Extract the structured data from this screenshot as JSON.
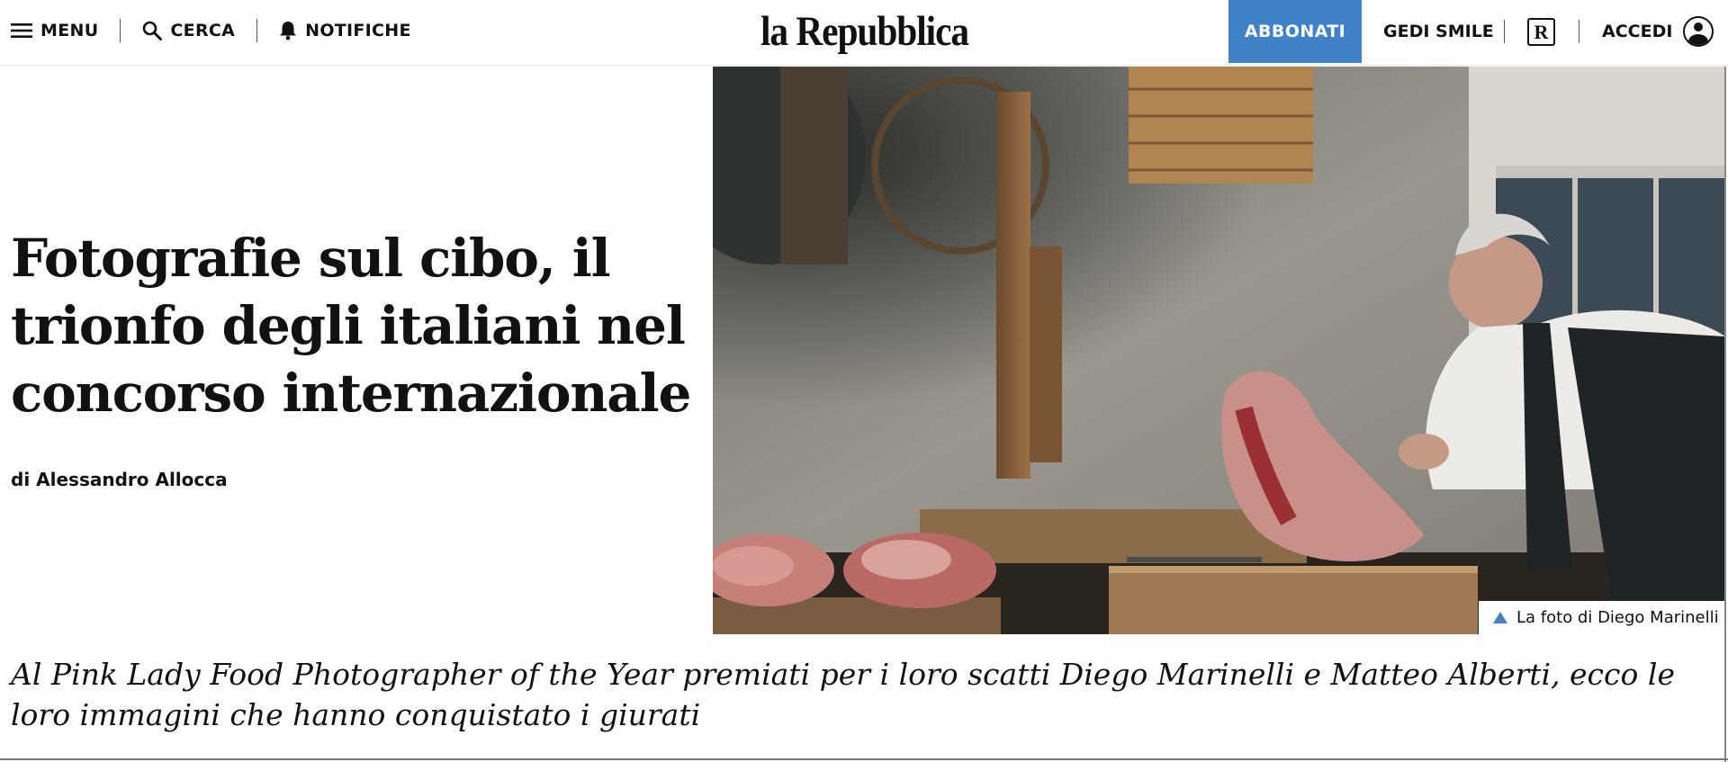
{
  "header": {
    "menu_label": "MENU",
    "search_label": "CERCA",
    "notifications_label": "NOTIFICHE",
    "logo_text": "la Repubblica",
    "subscribe_label": "ABBONATI",
    "gedi_label": "GEDI SMILE",
    "r_badge": "R",
    "login_label": "ACCEDI"
  },
  "article": {
    "title": "Fotografie sul cibo, il trionfo degli italiani nel concorso internazionale",
    "byline": "di Alessandro Allocca",
    "photo_caption": "La foto di Diego Marinelli",
    "summary": "Al Pink Lady Food Photographer of the Year premiati per i loro scatti Diego Marinelli e Matteo Alberti, ecco le loro immagini che hanno conquistato i giurati"
  },
  "colors": {
    "accent": "#3f82c8",
    "text": "#111111",
    "background": "#ffffff"
  }
}
